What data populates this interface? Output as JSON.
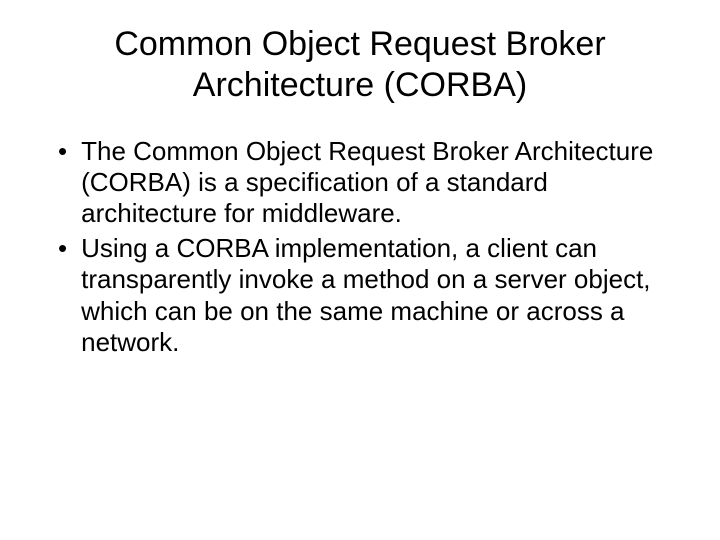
{
  "slide": {
    "title": "Common Object Request Broker Architecture (CORBA)",
    "bullets": [
      "The Common Object Request Broker Architecture (CORBA) is a specification of a standard architecture for middleware.",
      "Using a CORBA implementation, a client can transparently invoke a method on a server object, which can be on the same machine or across a network."
    ]
  }
}
